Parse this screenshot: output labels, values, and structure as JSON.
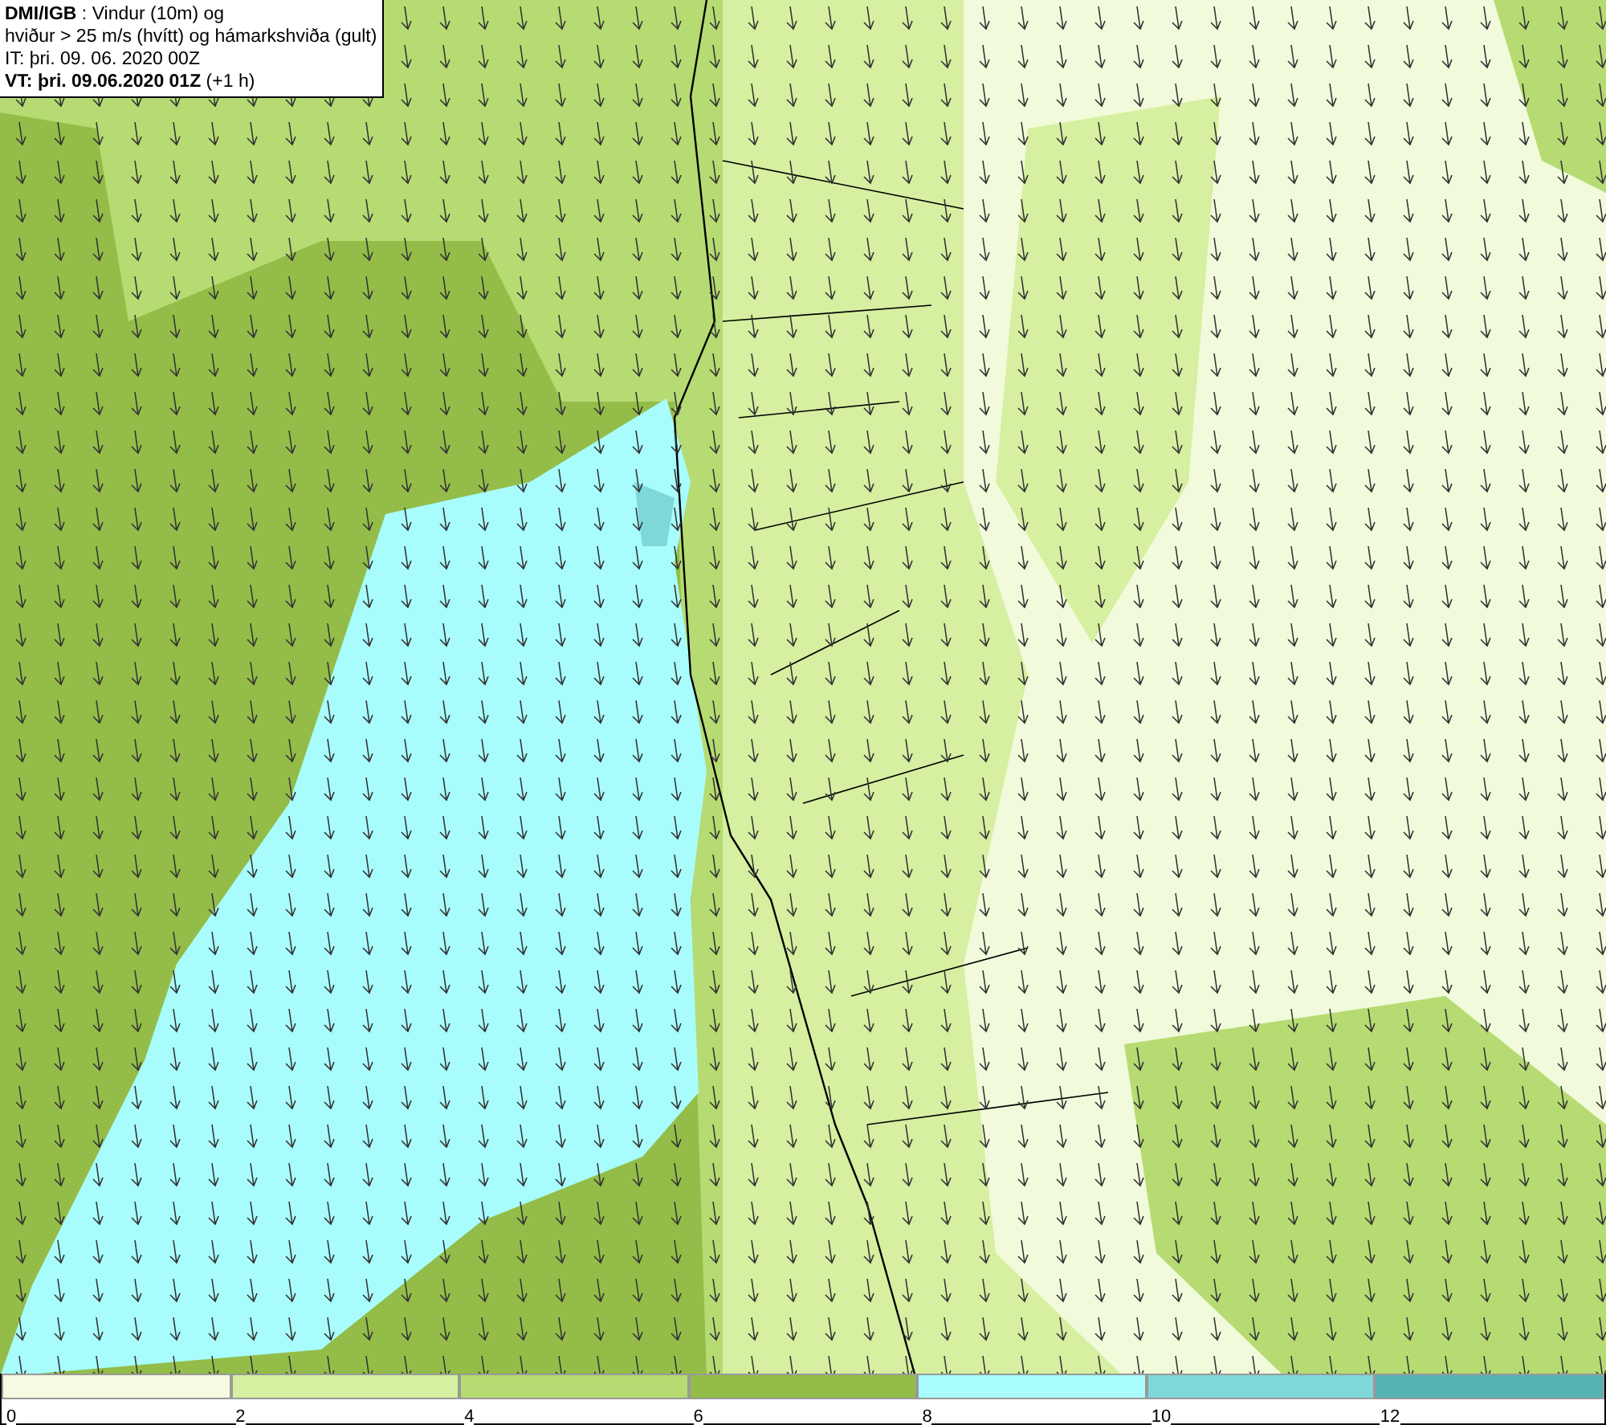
{
  "header": {
    "lines": [
      "**DMI/IGB** : Vindur (10m) og",
      "hviður > 25 m/s (hvítt) og hámarkshviða (gult)",
      "IT: þri. 09. 06. 2020 00Z",
      "**VT: þri. 09.06.2020 01Z** (+1 h)"
    ]
  },
  "legend": {
    "bins": [
      {
        "color": "#f4fbe0"
      },
      {
        "color": "#d6efa0"
      },
      {
        "color": "#b6db72"
      },
      {
        "color": "#93bd48"
      },
      {
        "color": "#a8fcfc"
      },
      {
        "color": "#7ed8d8"
      },
      {
        "color": "#54b4b4"
      }
    ],
    "ticks": [
      "0",
      "2",
      "4",
      "6",
      "8",
      "10",
      "12"
    ]
  }
}
